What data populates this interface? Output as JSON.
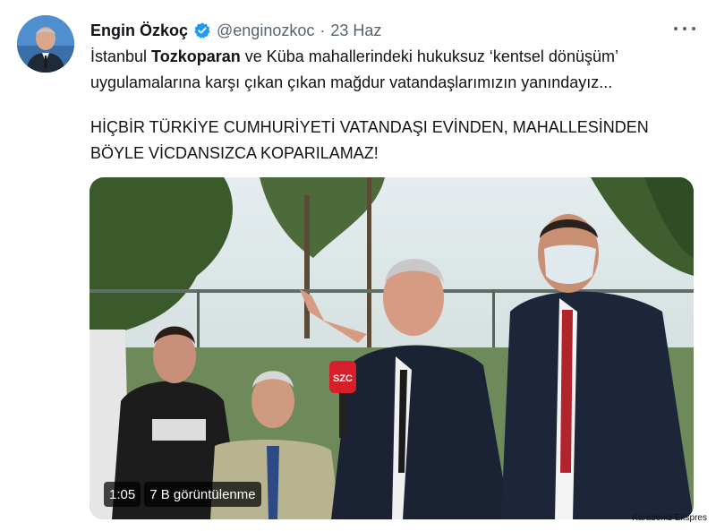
{
  "author": {
    "display_name": "Engin Özkoç",
    "handle": "@enginozkoc",
    "separator": "·",
    "date": "23 Haz"
  },
  "tweet": {
    "line1_start": "İstanbul ",
    "line1_bold": "Tozkoparan",
    "line1_end": " ve Küba mahallerindeki hukuksuz ‘kentsel dönüşüm’",
    "line2": "uygulamalarına karşı çıkan çıkan mağdur vatandaşlarımızın yanındayız...",
    "line3": "HİÇBİR TÜRKİYE CUMHURİYETİ VATANDAŞI EVİNDEN, MAHALLESİNDEN",
    "line4": "BÖYLE VİCDANSIZCA KOPARILAMAZ!"
  },
  "video": {
    "duration": "1:05",
    "views": "7 B görüntülenme",
    "mic_label": "SZC"
  },
  "watermark": "Karadeniz Ekspres",
  "icons": {
    "verified": "verified-badge-icon",
    "more": "more-options-icon"
  },
  "colors": {
    "verified_blue": "#1d9bf0",
    "secondary_text": "#536471",
    "primary_text": "#0f1419"
  }
}
